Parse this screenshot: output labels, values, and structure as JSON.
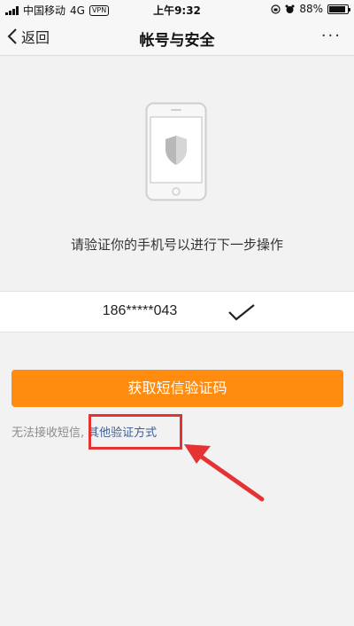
{
  "status_bar": {
    "carrier": "中国移动",
    "network": "4G",
    "vpn": "VPN",
    "time": "上午9:32",
    "battery_percent": "88%",
    "battery_level": 0.88
  },
  "nav": {
    "back_label": "返回",
    "title": "帐号与安全",
    "more_label": "···"
  },
  "main": {
    "instruction": "请验证你的手机号以进行下一步操作",
    "phone_number": "186*****043",
    "sms_button_label": "获取短信验证码",
    "cannot_receive_text": "无法接收短信,",
    "other_method_link": "其他验证方式"
  },
  "colors": {
    "accent_button": "#ff8b0f",
    "link": "#3a5e98",
    "annotation_red": "#e53333"
  },
  "icons": [
    "back-chevron-icon",
    "more-icon",
    "shield-icon",
    "check-icon",
    "annotation-arrow-icon"
  ]
}
